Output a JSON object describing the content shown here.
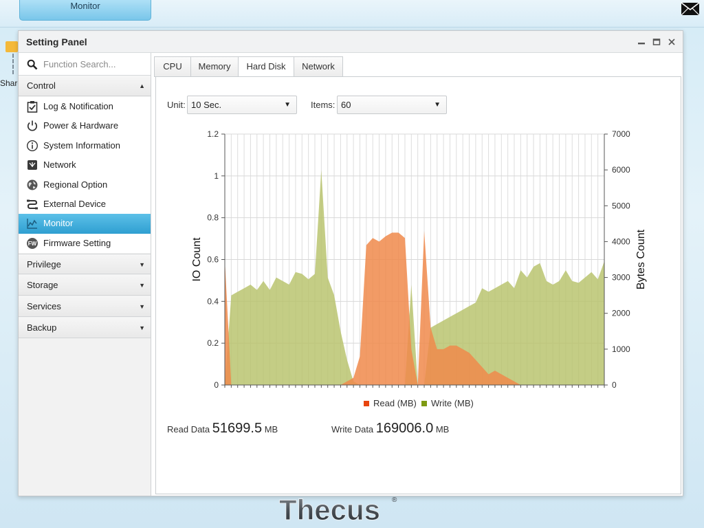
{
  "topbar": {
    "tab_label": "Monitor"
  },
  "desktop": {
    "icon_label": "Share"
  },
  "window": {
    "title": "Setting Panel"
  },
  "sidebar": {
    "search_placeholder": "Function Search...",
    "control_header": "Control",
    "items": [
      {
        "label": "Log & Notification",
        "icon": "clipboard-check-icon"
      },
      {
        "label": "Power & Hardware",
        "icon": "power-icon"
      },
      {
        "label": "System Information",
        "icon": "info-icon"
      },
      {
        "label": "Network",
        "icon": "network-icon"
      },
      {
        "label": "Regional Option",
        "icon": "globe-icon"
      },
      {
        "label": "External Device",
        "icon": "usb-icon"
      },
      {
        "label": "Monitor",
        "icon": "chart-icon",
        "active": true
      },
      {
        "label": "Firmware Setting",
        "icon": "firmware-icon",
        "badge": "FW"
      }
    ],
    "sections": [
      "Privilege",
      "Storage",
      "Services",
      "Backup"
    ]
  },
  "tabs": [
    "CPU",
    "Memory",
    "Hard Disk",
    "Network"
  ],
  "active_tab": "Hard Disk",
  "controls": {
    "unit_label": "Unit:",
    "unit_value": "10 Sec.",
    "items_label": "Items:",
    "items_value": "60"
  },
  "stats": {
    "read_label": "Read Data",
    "read_value": "51699.5",
    "read_unit": "MB",
    "write_label": "Write Data",
    "write_value": "169006.0",
    "write_unit": "MB"
  },
  "brand": {
    "logo_text": "Thecus"
  },
  "colors": {
    "active_blue": "#35a7d8",
    "read_series": "#f08a4b",
    "read_legend": "#e8450f",
    "write_series": "#b7c26a",
    "write_legend": "#7e9a13"
  },
  "chart_data": {
    "type": "area",
    "x": [
      0,
      1,
      2,
      3,
      4,
      5,
      6,
      7,
      8,
      9,
      10,
      11,
      12,
      13,
      14,
      15,
      16,
      17,
      18,
      19,
      20,
      21,
      22,
      23,
      24,
      25,
      26,
      27,
      28,
      29,
      30,
      31,
      32,
      33,
      34,
      35,
      36,
      37,
      38,
      39,
      40,
      41,
      42,
      43,
      44,
      45,
      46,
      47,
      48,
      49,
      50,
      51,
      52,
      53,
      54,
      55,
      56,
      57,
      58,
      59
    ],
    "ylabel": "IO Count",
    "y2label": "Bytes Count",
    "ylim": [
      0,
      1.2
    ],
    "y2lim": [
      0,
      7000
    ],
    "yticks": [
      "0",
      "0.2",
      "0.4",
      "0.6",
      "0.8",
      "1",
      "1.2"
    ],
    "y2ticks": [
      "0",
      "1000",
      "2000",
      "3000",
      "4000",
      "5000",
      "6000",
      "7000"
    ],
    "grid": true,
    "legend_position": "bottom",
    "series": [
      {
        "name": "Read (MB)",
        "axis": "right",
        "values": [
          3500,
          0,
          0,
          0,
          0,
          0,
          0,
          0,
          0,
          0,
          0,
          0,
          0,
          0,
          0,
          0,
          0,
          0,
          0,
          100,
          200,
          800,
          3900,
          4100,
          4000,
          4150,
          4250,
          4250,
          4100,
          1000,
          0,
          4300,
          1600,
          1000,
          1000,
          1100,
          1100,
          1000,
          900,
          700,
          500,
          300,
          400,
          300,
          200,
          100,
          0,
          0,
          0,
          0,
          0,
          0,
          0,
          0,
          0,
          0,
          0,
          0,
          0,
          0
        ]
      },
      {
        "name": "Write (MB)",
        "axis": "right",
        "values": [
          0,
          2500,
          2600,
          2700,
          2800,
          2650,
          2900,
          2650,
          3000,
          2900,
          2800,
          3150,
          3100,
          2950,
          3100,
          6000,
          3000,
          2500,
          1500,
          700,
          100,
          0,
          0,
          0,
          0,
          0,
          0,
          0,
          0,
          2800,
          0,
          0,
          1600,
          1700,
          1800,
          1900,
          2000,
          2100,
          2200,
          2300,
          2700,
          2600,
          2700,
          2800,
          2900,
          2700,
          3200,
          3000,
          3300,
          3400,
          2900,
          2800,
          2900,
          3200,
          2900,
          2850,
          3000,
          3150,
          2950,
          3450
        ]
      }
    ]
  }
}
